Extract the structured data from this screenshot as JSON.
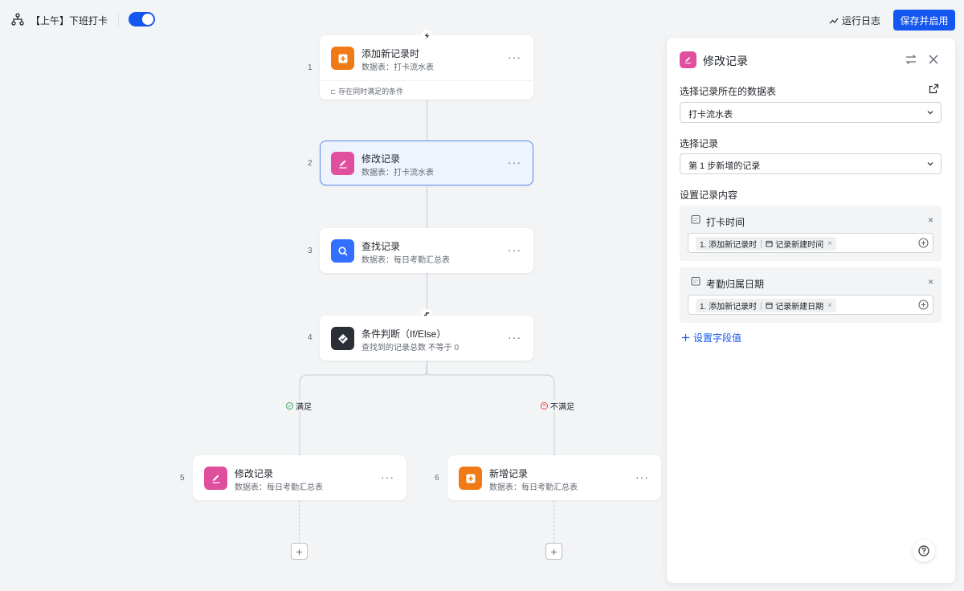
{
  "header": {
    "workflow_title": "【上午】下班打卡",
    "enabled": true,
    "run_log_label": "运行日志",
    "save_label": "保存并启用"
  },
  "canvas": {
    "nodes": [
      {
        "step": "1",
        "title": "添加新记录时",
        "subtitle": "数据表：打卡流水表",
        "icon": "add-record-icon",
        "color": "#f07b16",
        "footer": "存在同时满足的条件"
      },
      {
        "step": "2",
        "title": "修改记录",
        "subtitle": "数据表：打卡流水表",
        "icon": "edit-icon",
        "color": "#e04f9e",
        "selected": true
      },
      {
        "step": "3",
        "title": "查找记录",
        "subtitle": "数据表：每日考勤汇总表",
        "icon": "search-icon",
        "color": "#3370ff"
      },
      {
        "step": "4",
        "title": "条件判断（If/Else）",
        "subtitle": "查找到的记录总数 不等于 0",
        "icon": "condition-icon",
        "color": "#2b2f36"
      },
      {
        "step": "5",
        "title": "修改记录",
        "subtitle": "数据表：每日考勤汇总表",
        "icon": "edit-icon",
        "color": "#e04f9e"
      },
      {
        "step": "6",
        "title": "新增记录",
        "subtitle": "数据表：每日考勤汇总表",
        "icon": "add-record-icon",
        "color": "#f07b16"
      }
    ],
    "branches": {
      "yes": "满足",
      "no": "不满足"
    },
    "more_glyph": "···",
    "add_glyph": "+"
  },
  "panel": {
    "title": "修改记录",
    "table_label": "选择记录所在的数据表",
    "table_value": "打卡流水表",
    "record_label": "选择记录",
    "record_value": "第 1 步新增的记录",
    "content_label": "设置记录内容",
    "fields": [
      {
        "name": "打卡时间",
        "chip_step": "1. 添加新记录时",
        "chip_field": "记录新建时间"
      },
      {
        "name": "考勤归属日期",
        "chip_step": "1. 添加新记录时",
        "chip_field": "记录新建日期"
      }
    ],
    "add_field_label": "设置字段值",
    "close_glyph": "×"
  }
}
